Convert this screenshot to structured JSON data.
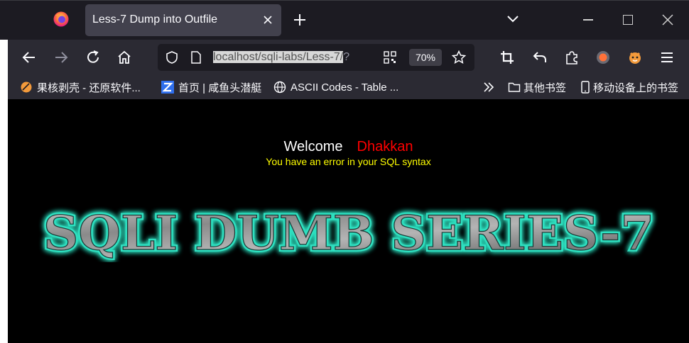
{
  "browser": {
    "tab_title": "Less-7 Dump into Outfile",
    "url_selected": "localhost/sqli-labs/Less-7/",
    "url_rest": "?",
    "zoom": "70%"
  },
  "bookmarks": [
    {
      "label": "果核剥壳 - 还原软件...",
      "icon": "orange-circle-icon"
    },
    {
      "label": "首页 | 咸鱼头潜艇",
      "icon": "z-logo-icon"
    },
    {
      "label": "ASCII Codes - Table ...",
      "icon": "globe-icon"
    }
  ],
  "bookmarks_right": {
    "other": "其他书签",
    "mobile": "移动设备上的书签"
  },
  "page": {
    "welcome": "Welcome",
    "user": "Dhakkan",
    "error": "You have an error in your SQL syntax",
    "banner": "SQLI DUMB SERIES-7"
  },
  "colors": {
    "welcome": "#ffffff",
    "user": "#ff0000",
    "error": "#ffff00",
    "banner_glow": "#2fe0c0",
    "banner_fill": "#9a9a9a"
  }
}
